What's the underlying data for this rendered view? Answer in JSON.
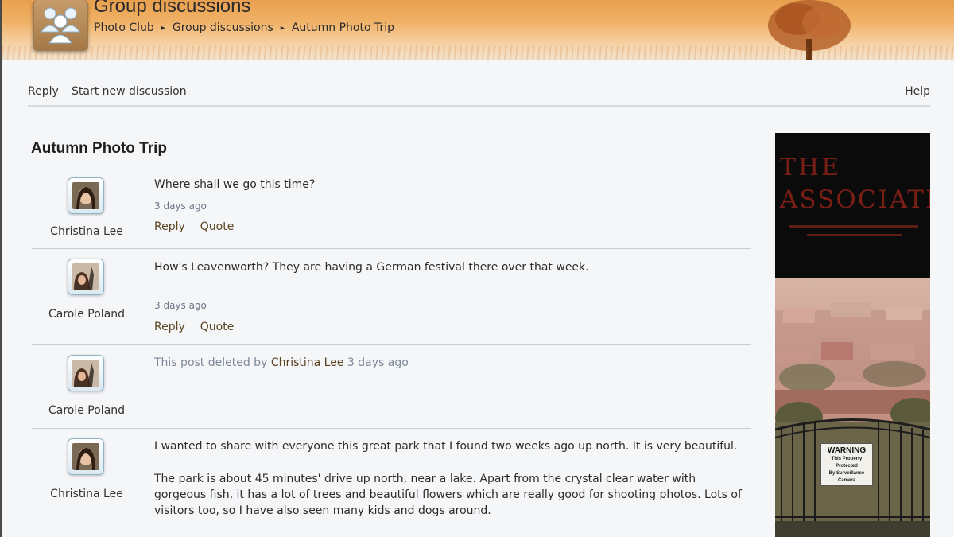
{
  "header": {
    "title": "Group discussions",
    "breadcrumb": [
      "Photo Club",
      "Group discussions",
      "Autumn Photo Trip"
    ],
    "breadcrumb_separator": "▸",
    "accent_color": "#e8a04e"
  },
  "toolbar": {
    "reply_label": "Reply",
    "new_discussion_label": "Start new discussion",
    "help_label": "Help"
  },
  "thread": {
    "title": "Autumn Photo Trip",
    "posts": [
      {
        "author": "Christina Lee",
        "body": "Where shall we go this time?",
        "timestamp": "3 days ago",
        "actions": [
          "Reply",
          "Quote"
        ]
      },
      {
        "author": "Carole Poland",
        "body": "How's Leavenworth? They are having a German festival there over that week.",
        "timestamp": "3 days ago",
        "actions": [
          "Reply",
          "Quote"
        ]
      },
      {
        "author": "Carole Poland",
        "deleted_prefix": "This post deleted by",
        "deleted_by": "Christina Lee",
        "timestamp": "3 days ago"
      },
      {
        "author": "Christina Lee",
        "body": "I wanted to share with everyone this great park that I found two weeks ago up north. It is very beautiful.",
        "body2": "The park is about 45 minutes' drive up north, near a lake. Apart from the crystal clear water with gorgeous fish, it has a lot of trees and beautiful flowers which are really good for shooting photos. Lots of visitors too, so I have also seen many kids and dogs around."
      }
    ]
  },
  "ad": {
    "title_line1": "THE",
    "title_line2": "ASSOCIATION",
    "sign_line1": "WARNING",
    "sign_line2": "This Property",
    "sign_line3": "Protected",
    "sign_line4": "By Surveillance",
    "sign_line5": "Camera"
  }
}
